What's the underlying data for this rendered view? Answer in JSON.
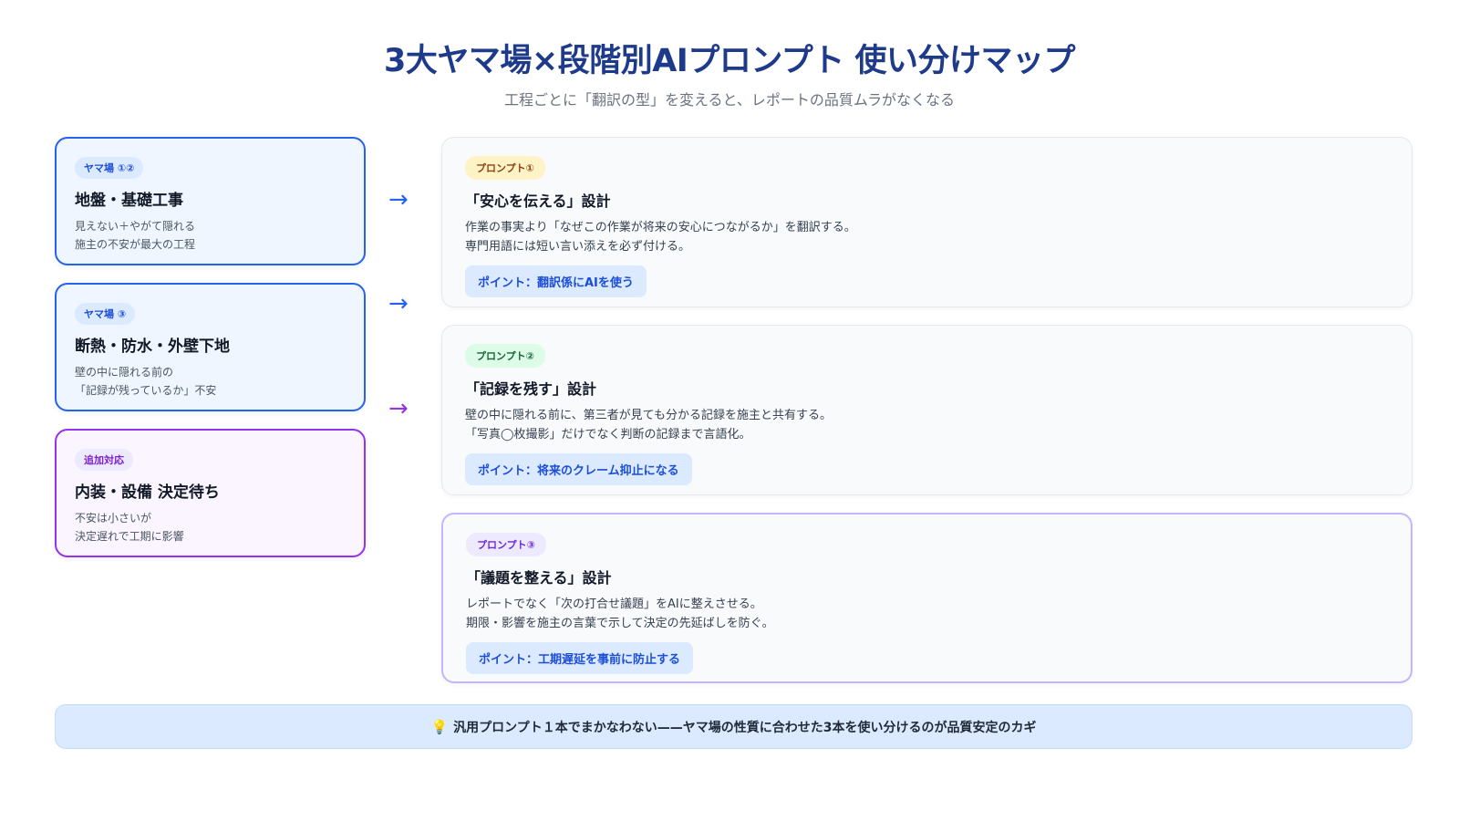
{
  "header": {
    "title": "3大ヤマ場×段階別AIプロンプト 使い分けマップ",
    "subtitle": "工程ごとに「翻訳の型」を変えると、レポートの品質ムラがなくなる"
  },
  "stages": [
    {
      "badge": "ヤマ場 ①②",
      "title": "地盤・基礎工事",
      "desc_line1": "見えない＋やがて隠れる",
      "desc_line2": "施主の不安が最大の工程"
    },
    {
      "badge": "ヤマ場 ③",
      "title": "断熱・防水・外壁下地",
      "desc_line1": "壁の中に隠れる前の",
      "desc_line2": "「記録が残っているか」不安"
    },
    {
      "badge": "追加対応",
      "title": "内装・設備 決定待ち",
      "desc_line1": "不安は小さいが",
      "desc_line2": "決定遅れで工期に影響"
    }
  ],
  "arrows": [
    "→",
    "→",
    "→"
  ],
  "prompts": [
    {
      "badge": "プロンプト①",
      "title": "「安心を伝える」設計",
      "desc_line1": "作業の事実より「なぜこの作業が将来の安心につながるか」を翻訳する。",
      "desc_line2": "専門用語には短い言い添えを必ず付ける。",
      "point": "ポイント：翻訳係にAIを使う"
    },
    {
      "badge": "プロンプト②",
      "title": "「記録を残す」設計",
      "desc_line1": "壁の中に隠れる前に、第三者が見ても分かる記録を施主と共有する。",
      "desc_line2": "「写真◯枚撮影」だけでなく判断の記録まで言語化。",
      "point": "ポイント：将来のクレーム抑止になる"
    },
    {
      "badge": "プロンプト③",
      "title": "「議題を整える」設計",
      "desc_line1": "レポートでなく「次の打合せ議題」をAIに整えさせる。",
      "desc_line2": "期限・影響を施主の言葉で示して決定の先延ばしを防ぐ。",
      "point": "ポイント：工期遅延を事前に防止する"
    }
  ],
  "footer": {
    "icon": "lightbulb-icon",
    "text": "汎用プロンプト１本でまかなわない——ヤマ場の性質に合わせた3本を使い分けるのが品質安定のカギ"
  }
}
